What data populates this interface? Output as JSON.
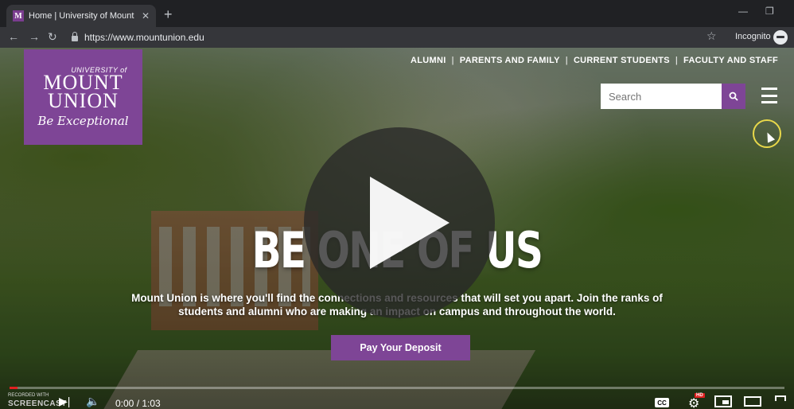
{
  "browser": {
    "tab_title": "Home | University of Mount Unio",
    "favicon_letter": "M",
    "url": "https://www.mountunion.edu",
    "incognito_label": "Incognito"
  },
  "site": {
    "logo": {
      "university": "UNIVERSITY of",
      "mount": "MOUNT",
      "union": "UNION",
      "tagline": "Be Exceptional"
    },
    "nav": [
      "ALUMNI",
      "PARENTS AND FAMILY",
      "CURRENT STUDENTS",
      "FACULTY AND STAFF"
    ],
    "nav_separator": "|",
    "search_placeholder": "Search",
    "headline": "BE ONE OF US",
    "subline_1": "Mount Union is where you'll find the connections and resources that will set you apart. Join the ranks of",
    "subline_2": "students and alumni who are making an impact on campus and throughout the world.",
    "cta": "Pay Your Deposit",
    "brand_color": "#7e4596"
  },
  "player": {
    "time": "0:00 / 1:03",
    "progress": 0.01,
    "recorded_with": "RECORDED WITH",
    "brand": "SCREENCAST",
    "cc_label": "CC",
    "hd_label": "HD"
  }
}
